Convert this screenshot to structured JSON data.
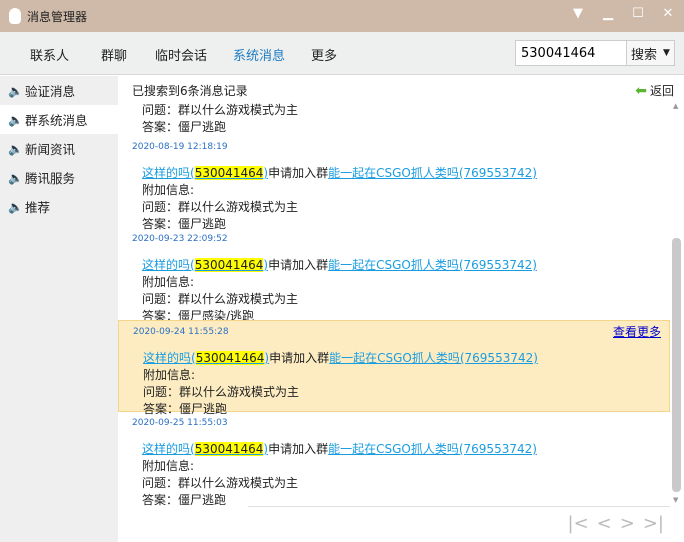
{
  "window": {
    "title": "消息管理器",
    "btn_menu": "▼",
    "btn_min": "▁",
    "btn_max": "☐",
    "btn_close": "✕"
  },
  "tabs": [
    "联系人",
    "群聊",
    "临时会话",
    "系统消息",
    "更多"
  ],
  "search": {
    "value": "530041464",
    "button": "搜索"
  },
  "sidebar": [
    "验证消息",
    "群系统消息",
    "新闻资讯",
    "腾讯服务",
    "推荐"
  ],
  "header": {
    "result": "已搜索到6条消息记录",
    "back": "返回"
  },
  "partial": {
    "question": "问题：群以什么游戏模式为主",
    "answer": "答案：僵尸逃跑"
  },
  "messages": [
    {
      "time": "2020-08-19 12:18:19",
      "user": "这样的吗(",
      "qq": "530041464",
      "close": ")",
      "action": "申请加入群",
      "group": "能一起在CSGO抓人类吗(769553742)",
      "extra": "附加信息:",
      "question": "问题：群以什么游戏模式为主",
      "answer": "答案：僵尸逃跑"
    },
    {
      "time": "2020-09-23 22:09:52",
      "user": "这样的吗(",
      "qq": "530041464",
      "close": ")",
      "action": "申请加入群",
      "group": "能一起在CSGO抓人类吗(769553742)",
      "extra": "附加信息:",
      "question": "问题：群以什么游戏模式为主",
      "answer": "答案：僵尸感染/逃跑"
    },
    {
      "time": "2020-09-24 11:55:28",
      "user": "这样的吗(",
      "qq": "530041464",
      "close": ")",
      "action": "申请加入群",
      "group": "能一起在CSGO抓人类吗(769553742)",
      "extra": "附加信息:",
      "question": "问题：群以什么游戏模式为主",
      "answer": "答案：僵尸逃跑",
      "more": "查看更多"
    },
    {
      "time": "2020-09-25 11:55:03",
      "user": "这样的吗(",
      "qq": "530041464",
      "close": ")",
      "action": "申请加入群",
      "group": "能一起在CSGO抓人类吗(769553742)",
      "extra": "附加信息:",
      "question": "问题：群以什么游戏模式为主",
      "answer": "答案：僵尸逃跑"
    }
  ],
  "pager": {
    "first": "|<",
    "prev": "<",
    "next": ">",
    "last": ">|"
  }
}
